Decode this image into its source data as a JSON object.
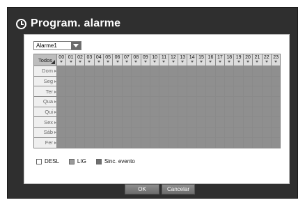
{
  "dialog": {
    "title": "Program. alarme"
  },
  "alarm_select": {
    "value": "Alarme1"
  },
  "grid": {
    "corner_label": "Todos",
    "hours": [
      "00",
      "01",
      "02",
      "03",
      "04",
      "05",
      "06",
      "07",
      "08",
      "09",
      "10",
      "11",
      "12",
      "13",
      "14",
      "15",
      "16",
      "17",
      "18",
      "19",
      "20",
      "21",
      "22",
      "23"
    ],
    "days": [
      "Dom",
      "Seg",
      "Ter",
      "Qua",
      "Qui",
      "Sex",
      "Sáb",
      "Fer"
    ],
    "cell_state": "LIG"
  },
  "legend": {
    "off_label": "DESL",
    "on_label": "LIG",
    "sync_label": "Sinc. evento"
  },
  "buttons": {
    "ok_label": "OK",
    "cancel_label": "Cancelar"
  },
  "colors": {
    "dialog_bg": "#2f2f2f",
    "cell_on": "#8f8f8f",
    "button": "#7a7a7a"
  }
}
